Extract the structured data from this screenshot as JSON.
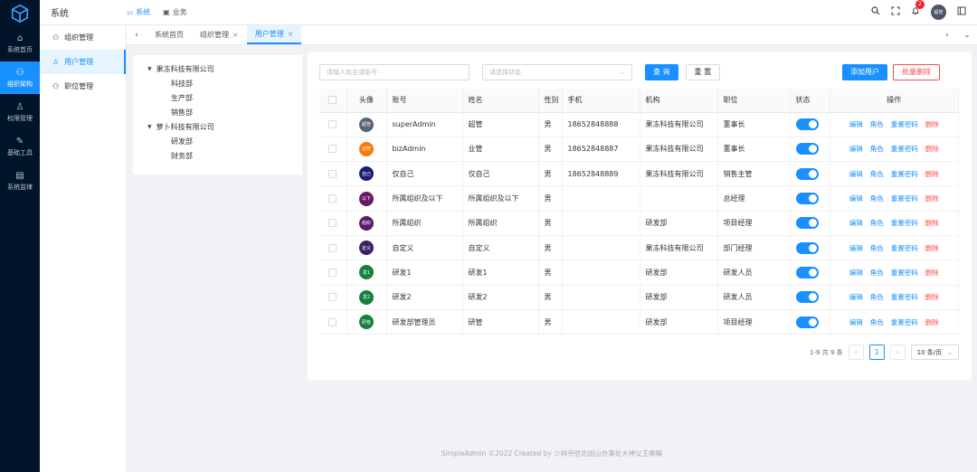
{
  "rail": {
    "items": [
      {
        "label": "系统首页",
        "icon": "home-icon",
        "glyph": "⌂"
      },
      {
        "label": "组织架构",
        "icon": "org-icon",
        "glyph": "⚇"
      },
      {
        "label": "权限管理",
        "icon": "user-lock-icon",
        "glyph": "♙"
      },
      {
        "label": "基础工具",
        "icon": "wrench-icon",
        "glyph": "✎"
      },
      {
        "label": "系统监律",
        "icon": "document-icon",
        "glyph": "▤"
      }
    ],
    "active_index": 1
  },
  "topbar": {
    "title": "系统",
    "tabs": [
      {
        "label": "系统",
        "glyph": "⚏"
      },
      {
        "label": "业务",
        "glyph": "▣"
      }
    ],
    "notification_count": "2",
    "avatar_text": "超管"
  },
  "submenu": {
    "items": [
      {
        "label": "组织管理",
        "glyph": "⚇"
      },
      {
        "label": "用户管理",
        "glyph": "♙"
      },
      {
        "label": "职位管理",
        "glyph": "⚇"
      }
    ]
  },
  "tabs": {
    "items": [
      {
        "label": "系统首页",
        "closable": false,
        "active": false
      },
      {
        "label": "组织管理",
        "closable": true,
        "active": false
      },
      {
        "label": "用户管理",
        "closable": true,
        "active": true
      }
    ]
  },
  "tree": {
    "nodes": [
      {
        "label": "果冻科技有限公司",
        "level": 0
      },
      {
        "label": "科技部",
        "level": 1
      },
      {
        "label": "生产部",
        "level": 1
      },
      {
        "label": "销售部",
        "level": 1
      },
      {
        "label": "萝卜科技有限公司",
        "level": 0
      },
      {
        "label": "研发部",
        "level": 1
      },
      {
        "label": "财务部",
        "level": 1
      }
    ]
  },
  "filter": {
    "search_placeholder": "请输入姓名或账号",
    "status_placeholder": "请选择状态",
    "query_label": "查 询",
    "reset_label": "重 置",
    "add_label": "添加用户",
    "batch_delete_label": "批量删除"
  },
  "table": {
    "headers": [
      "头像",
      "账号",
      "姓名",
      "性别",
      "手机",
      "机构",
      "职位",
      "状态",
      "操作"
    ],
    "actions": [
      "编辑",
      "角色",
      "重置密码",
      "删除"
    ],
    "rows": [
      {
        "avatar": "超管",
        "avatar_color": "#5b6475",
        "account": "superAdmin",
        "name": "超管",
        "gender": "男",
        "phone": "18652848888",
        "org": "果冻科技有限公司",
        "position": "董事长",
        "enabled": true
      },
      {
        "avatar": "业管",
        "avatar_color": "#f77a0c",
        "account": "bizAdmin",
        "name": "业管",
        "gender": "男",
        "phone": "18652848887",
        "org": "果冻科技有限公司",
        "position": "董事长",
        "enabled": true
      },
      {
        "avatar": "自己",
        "avatar_color": "#1c1c7a",
        "account": "仅自己",
        "name": "仅自己",
        "gender": "男",
        "phone": "18652848889",
        "org": "果冻科技有限公司",
        "position": "销售主管",
        "enabled": true
      },
      {
        "avatar": "以下",
        "avatar_color": "#6b1a66",
        "account": "所属组织及以下",
        "name": "所属组织及以下",
        "gender": "男",
        "phone": "",
        "org": "",
        "position": "总经理",
        "enabled": true
      },
      {
        "avatar": "组织",
        "avatar_color": "#5a1a6e",
        "account": "所属组织",
        "name": "所属组织",
        "gender": "男",
        "phone": "",
        "org": "研发部",
        "position": "项目经理",
        "enabled": true
      },
      {
        "avatar": "定义",
        "avatar_color": "#3b2466",
        "account": "自定义",
        "name": "自定义",
        "gender": "男",
        "phone": "",
        "org": "果冻科技有限公司",
        "position": "部门经理",
        "enabled": true
      },
      {
        "avatar": "发1",
        "avatar_color": "#17803d",
        "account": "研发1",
        "name": "研发1",
        "gender": "男",
        "phone": "",
        "org": "研发部",
        "position": "研发人员",
        "enabled": true
      },
      {
        "avatar": "发2",
        "avatar_color": "#17803d",
        "account": "研发2",
        "name": "研发2",
        "gender": "男",
        "phone": "",
        "org": "研发部",
        "position": "研发人员",
        "enabled": true
      },
      {
        "avatar": "研管",
        "avatar_color": "#17803d",
        "account": "研发部管理员",
        "name": "研管",
        "gender": "男",
        "phone": "",
        "org": "研发部",
        "position": "项目经理",
        "enabled": true
      }
    ]
  },
  "pagination": {
    "summary": "1-9 共 9 条",
    "current_page": "1",
    "page_size": "10 条/页"
  },
  "footer": {
    "text": "SimpleAdmin ©2022 Created by 少林寺驻北固山办事处大神父王喇嘛"
  }
}
